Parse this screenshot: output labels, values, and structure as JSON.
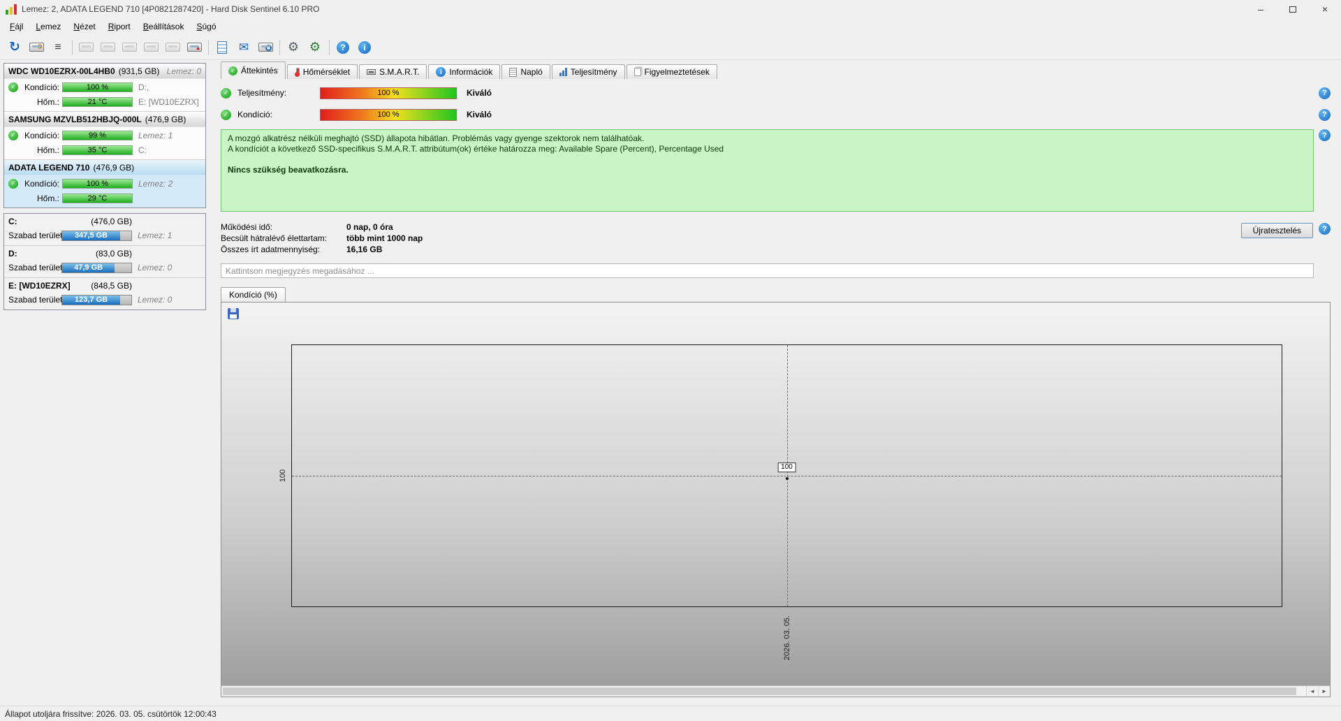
{
  "window": {
    "title": "Lemez: 2, ADATA LEGEND 710 [4P0821287420]  -  Hard Disk Sentinel 6.10 PRO",
    "controls": {
      "minimize": "–",
      "close": "×"
    }
  },
  "menubar": {
    "items": [
      {
        "label": "Fájl"
      },
      {
        "label": "Lemez"
      },
      {
        "label": "Nézet"
      },
      {
        "label": "Riport"
      },
      {
        "label": "Beállítások"
      },
      {
        "label": "Súgó"
      }
    ]
  },
  "toolbar": {
    "icons": [
      {
        "name": "refresh-icon",
        "glyph": "↻"
      },
      {
        "name": "disk-settings-icon",
        "glyph": "⚙"
      },
      {
        "name": "device-list-icon",
        "glyph": "≡"
      },
      {
        "name": "printer-icon",
        "glyph": ""
      },
      {
        "name": "save-report-icon",
        "glyph": ""
      },
      {
        "name": "disk-copy-icon",
        "glyph": ""
      },
      {
        "name": "disk-export-icon",
        "glyph": ""
      },
      {
        "name": "disk-tools-icon",
        "glyph": ""
      },
      {
        "name": "disk-eject-icon",
        "glyph": "▲"
      },
      {
        "name": "report-icon",
        "glyph": ""
      },
      {
        "name": "mail-icon",
        "glyph": "✉"
      },
      {
        "name": "disk-search-icon",
        "glyph": ""
      },
      {
        "name": "settings-gear-icon",
        "glyph": "⚙"
      },
      {
        "name": "advanced-settings-icon",
        "glyph": "⚙"
      },
      {
        "name": "help-icon",
        "glyph": "?"
      },
      {
        "name": "info-icon",
        "glyph": "i"
      }
    ]
  },
  "sidebar": {
    "disks": [
      {
        "name": "WDC WD10EZRX-00L4HB0",
        "size": "(931,5 GB)",
        "header_right": "Lemez: 0",
        "condition_label": "Kondíció:",
        "condition_value": "100 %",
        "temp_label": "Hőm.:",
        "temp_value": "21 °C",
        "row1_right": "D:,",
        "row2_right": "E: [WD10EZRX]"
      },
      {
        "name": "SAMSUNG MZVLB512HBJQ-000L",
        "size": "(476,9 GB)",
        "header_right": "",
        "condition_label": "Kondíció:",
        "condition_value": "99 %",
        "temp_label": "Hőm.:",
        "temp_value": "35 °C",
        "row1_right": "Lemez: 1",
        "row2_right": "C:"
      },
      {
        "name": "ADATA LEGEND 710",
        "size": "(476,9 GB)",
        "header_right": "",
        "condition_label": "Kondíció:",
        "condition_value": "100 %",
        "temp_label": "Hőm.:",
        "temp_value": "29 °C",
        "row1_right": "Lemez: 2",
        "row2_right": ""
      }
    ],
    "partitions": [
      {
        "name": "C:",
        "size": "(476,0 GB)",
        "free_label": "Szabad terület",
        "free_value": "347,5 GB",
        "right": "Lemez: 1",
        "bar_width": "84%"
      },
      {
        "name": "D:",
        "size": "(83,0 GB)",
        "free_label": "Szabad terület",
        "free_value": "47,9 GB",
        "right": "Lemez: 0",
        "bar_width": "76%"
      },
      {
        "name": "E: [WD10EZRX]",
        "size": "(848,5 GB)",
        "free_label": "Szabad terület",
        "free_value": "123,7 GB",
        "right": "Lemez: 0",
        "bar_width": "84%"
      }
    ]
  },
  "tabs": [
    {
      "label": "Áttekintés"
    },
    {
      "label": "Hőmérséklet"
    },
    {
      "label": "S.M.A.R.T."
    },
    {
      "label": "Információk"
    },
    {
      "label": "Napló"
    },
    {
      "label": "Teljesítmény"
    },
    {
      "label": "Figyelmeztetések"
    }
  ],
  "overview": {
    "performance": {
      "label": "Teljesítmény:",
      "bar_value": "100 %",
      "rating": "Kiváló"
    },
    "condition": {
      "label": "Kondíció:",
      "bar_value": "100 %",
      "rating": "Kiváló"
    },
    "message": {
      "line1": "A mozgó alkatrész nélküli meghajtó (SSD) állapota hibátlan. Problémás vagy gyenge szektorok nem találhatóak.",
      "line2": "A kondíciót a következő SSD-specifikus S.M.A.R.T. attribútum(ok) értéke határozza meg:  Available Spare (Percent), Percentage Used",
      "line3": "Nincs szükség beavatkozásra."
    },
    "stats": [
      {
        "label": "Működési idő:",
        "value": "0 nap, 0 óra"
      },
      {
        "label": "Becsült hátralévő élettartam:",
        "value": "több mint 1000 nap"
      },
      {
        "label": "Összes írt adatmennyiség:",
        "value": "16,16 GB"
      }
    ],
    "retest_button": "Újratesztelés",
    "comment_placeholder": "Kattintson megjegyzés megadásához ..."
  },
  "chart": {
    "tab_label": "Kondíció (%)",
    "y_tick": "100",
    "point_label": "100",
    "x_label": "2026. 03. 05."
  },
  "chart_data": {
    "type": "line",
    "title": "Kondíció (%)",
    "x": [
      "2026. 03. 05."
    ],
    "series": [
      {
        "name": "Kondíció (%)",
        "values": [
          100
        ]
      }
    ],
    "y_ticks": [
      100
    ],
    "point_labels": [
      "100"
    ],
    "grid": "dashed-crosshair",
    "legend": "none"
  },
  "statusbar": {
    "text": "Állapot utoljára frissítve: 2026. 03. 05. csütörtök 12:00:43"
  },
  "colors": {
    "accent_blue": "#1565c0",
    "ok_green": "#18a018",
    "condition_bar_green": "#28b428",
    "message_bg": "#c9f4c6",
    "selected_disk_bg": "#d4eaf8",
    "free_space_blue": "#1a6fc0"
  }
}
